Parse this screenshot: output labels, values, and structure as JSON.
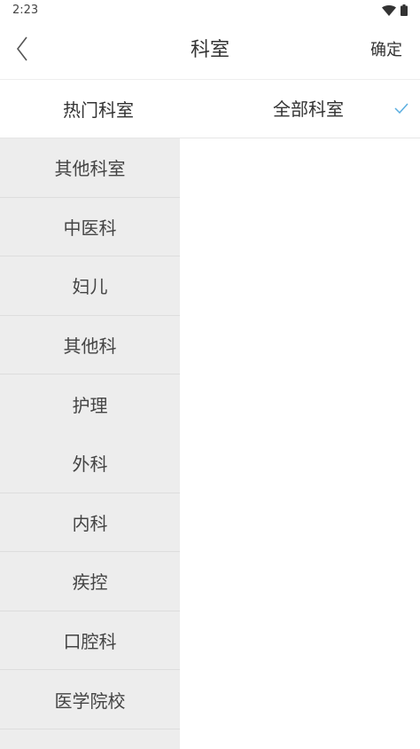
{
  "status_bar": {
    "time": "2:23",
    "icons": [
      "wifi-icon",
      "battery-icon"
    ]
  },
  "header": {
    "title": "科室",
    "confirm_label": "确定",
    "back_icon": "chevron-left-icon"
  },
  "tabs": {
    "hot_label": "热门科室",
    "all_label": "全部科室",
    "selected": "全部科室",
    "check_color": "#5aaee0"
  },
  "departments": [
    {
      "label": "其他科室"
    },
    {
      "label": "中医科"
    },
    {
      "label": "妇儿"
    },
    {
      "label": "其他科"
    },
    {
      "label": "护理"
    },
    {
      "label": "外科"
    },
    {
      "label": "内科"
    },
    {
      "label": "疾控"
    },
    {
      "label": "口腔科"
    },
    {
      "label": "医学院校"
    }
  ],
  "colors": {
    "list_background": "#ededed",
    "divider": "#dddddd",
    "text": "#333333"
  }
}
